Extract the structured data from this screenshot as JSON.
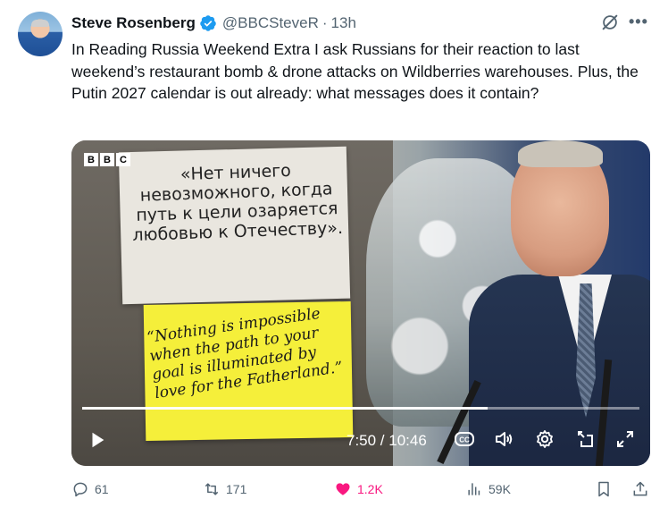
{
  "author": {
    "name": "Steve Rosenberg",
    "handle": "@BBCSteveR",
    "separator": "·",
    "time": "13h"
  },
  "tweet": {
    "text": "In Reading Russia Weekend Extra I ask Russians for their reaction to last weekend’s restaurant bomb & drone attacks on Wildberries warehouses. Plus, the Putin 2027 calendar is out already: what messages does it contain?"
  },
  "media": {
    "logo": [
      "B",
      "B",
      "C"
    ],
    "russian_quote": "«Нет ничего невозможного, когда путь к цели озаряется любовью к Отечеству».",
    "english_quote": "“Nothing is impossible when the path to your goal is illuminated by love for the Fatherland.”",
    "timecode": "7:50 / 10:46",
    "progress": 0.728
  },
  "actions": {
    "replies": "61",
    "reposts": "171",
    "likes": "1.2K",
    "views": "59K"
  },
  "colors": {
    "text": "#0f1419",
    "secondary": "#536471",
    "verified": "#1d9bf0",
    "like": "#f91880"
  }
}
